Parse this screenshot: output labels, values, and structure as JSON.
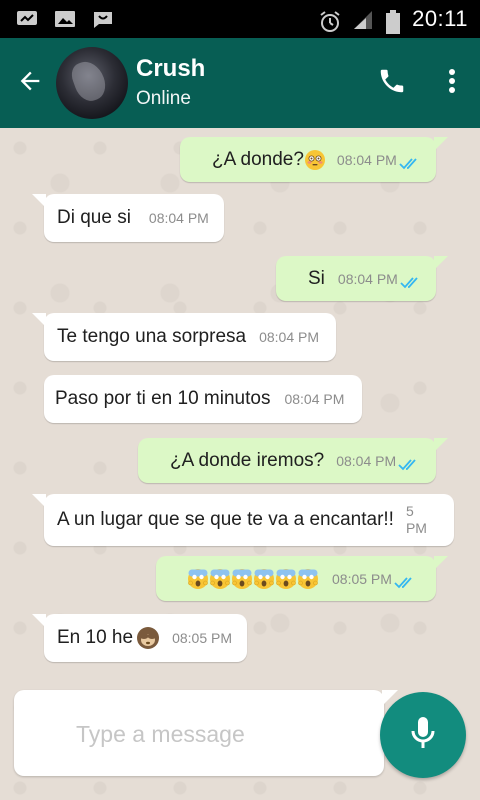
{
  "status_bar": {
    "time": "20:11",
    "icons": [
      "messages-icon",
      "image-icon",
      "chat-icon",
      "alarm-icon",
      "signal-icon",
      "battery-icon"
    ]
  },
  "header": {
    "contact_name": "Crush",
    "contact_status": "Online",
    "icons": {
      "back": "back-arrow-icon",
      "call": "phone-icon",
      "menu": "more-vert-icon"
    }
  },
  "colors": {
    "header": "#075e54",
    "outgoing_bubble": "#dcf8c6",
    "incoming_bubble": "#ffffff",
    "read_ticks": "#34b7f1",
    "mic_button": "#128c7e"
  },
  "messages": [
    {
      "direction": "out",
      "text": "¿A donde?",
      "emoji": "flushed-face",
      "time": "08:04 PM",
      "status": "read"
    },
    {
      "direction": "in",
      "text": "Di que si",
      "time": "08:04 PM"
    },
    {
      "direction": "out",
      "text": "Si",
      "time": "08:04 PM",
      "status": "read"
    },
    {
      "direction": "in",
      "text": "Te tengo una sorpresa",
      "time": "08:04 PM"
    },
    {
      "direction": "in",
      "text": "Paso por ti en 10 minutos",
      "time": "08:04 PM"
    },
    {
      "direction": "out",
      "text": "¿A donde iremos?",
      "time": "08:04 PM",
      "status": "read"
    },
    {
      "direction": "in",
      "text": "A un lugar que se que te va a encantar!!",
      "time_top": "5",
      "time_bottom": "PM"
    },
    {
      "direction": "out",
      "emoji": "face-screaming-in-fear x6",
      "time": "08:05 PM",
      "status": "read"
    },
    {
      "direction": "in",
      "text": "En 10 he",
      "emoji": "see-no-evil-monkey",
      "time": "08:05 PM"
    }
  ],
  "composer": {
    "placeholder": "Type a message",
    "value": "",
    "icons": {
      "send": "mic-icon"
    }
  }
}
